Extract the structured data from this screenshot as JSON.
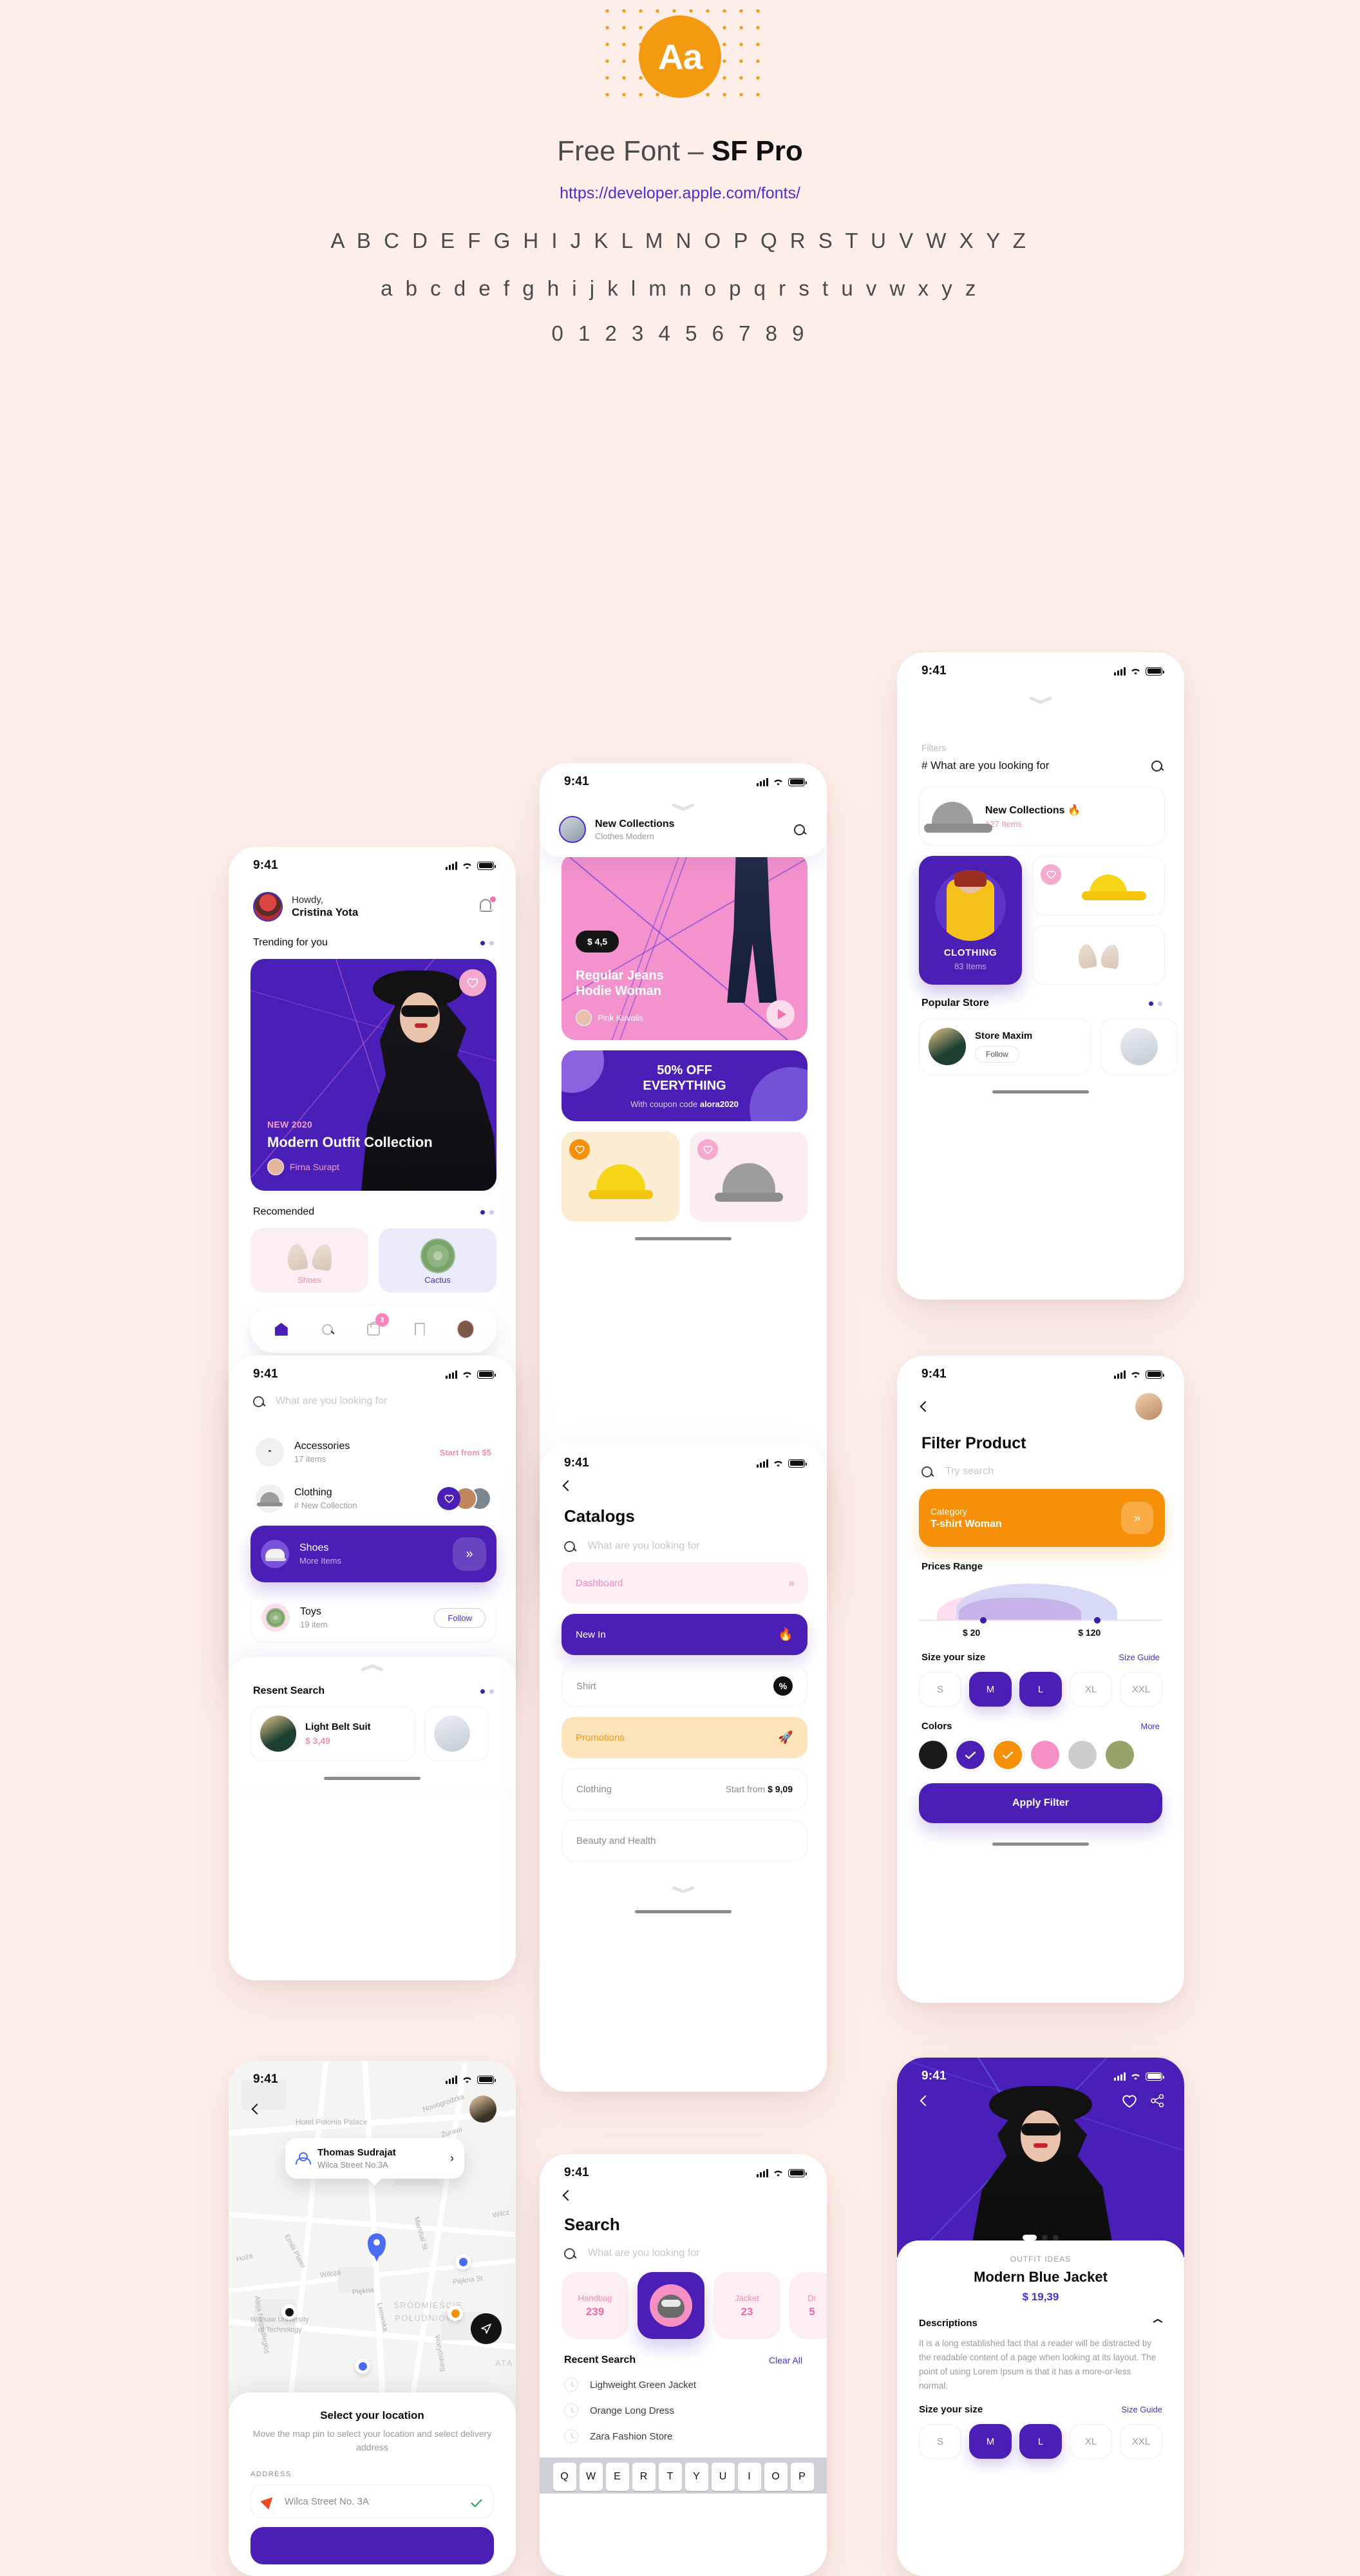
{
  "specimen": {
    "badge": "Aa",
    "title_light": "Free Font – ",
    "title_bold": "SF Pro",
    "url": "https://developer.apple.com/fonts/",
    "uppercase": "A B C D E F G H I J K L M N O P Q R S T U V W X Y Z",
    "lowercase": "a b c d e f g h i j k l m n o p q r s t u v w x y z",
    "numerals": "0 1 2 3 4 5 6 7 8 9"
  },
  "status_bar": {
    "time": "9:41"
  },
  "colors": {
    "accent_purple": "#4b1fb5",
    "accent_orange": "#f79009",
    "accent_pink": "#f489bb",
    "link_purple": "#4b2fd1",
    "page_bg": "#fdeeea"
  },
  "home_screen": {
    "greeting_line1": "Howdy,",
    "greeting_line2": "Cristina Yota",
    "section_trending": "Trending for you",
    "hero": {
      "tag": "NEW 2020",
      "title": "Modern Outfit Collection",
      "author": "Firna Surapt"
    },
    "section_recommended": "Recomended",
    "recommended": [
      {
        "label": "Shoes"
      },
      {
        "label": "Cactus"
      }
    ],
    "tabbar": {
      "cart_badge": "3"
    }
  },
  "new_collections": {
    "title": "New Collections",
    "subtitle": "Clothes Modern",
    "product": {
      "price": "$ 4,5",
      "title_line1": "Regular Jeans",
      "title_line2": "Hodie Woman",
      "author": "Pink Kuvalis"
    },
    "promo": {
      "line1": "50% OFF",
      "line2": "EVERYTHING",
      "sub_prefix": "With coupon code ",
      "sub_code": "alora2020"
    }
  },
  "filters_screen": {
    "label": "Filters",
    "query": "# What are you looking for",
    "featured": {
      "title": "New Collections 🔥",
      "items": "127 Items"
    },
    "clothing_card": {
      "title": "CLOTHING",
      "items": "83 Items"
    },
    "section_popular": "Popular Store",
    "store": {
      "name": "Store Maxim",
      "follow": "Follow"
    }
  },
  "categories_screen": {
    "search_placeholder": "What are you looking for",
    "items": [
      {
        "title": "Accessories",
        "sub": "17 items",
        "right": "Start from $5"
      },
      {
        "title": "Clothing",
        "sub": "# New Collection",
        "right": ""
      },
      {
        "title": "Shoes",
        "sub": "More Items",
        "right": ""
      },
      {
        "title": "Toys",
        "sub": "19 item",
        "right": "Follow"
      }
    ],
    "recent": {
      "title": "Resent Search",
      "item_title": "Light Belt Suit",
      "item_price": "$ 3,49"
    }
  },
  "catalogs_screen": {
    "title": "Catalogs",
    "search_placeholder": "What are you looking for",
    "items": [
      {
        "label": "Dashboard",
        "right": "»"
      },
      {
        "label": "New In",
        "right": "🔥"
      },
      {
        "label": "Shirt",
        "right": "%"
      },
      {
        "label": "Promotions",
        "right": "🚀"
      },
      {
        "label": "Clothing",
        "right_prefix": "Start from ",
        "right_value": "$ 9,09"
      },
      {
        "label": "Beauty and Health",
        "right": ""
      }
    ]
  },
  "filter_product_screen": {
    "title": "Filter Product",
    "search_placeholder": "Try search",
    "category": {
      "label": "Category",
      "value": "T-shirt Woman"
    },
    "prices": {
      "heading": "Prices Range",
      "min": "$ 20",
      "max": "$ 120"
    },
    "size": {
      "heading": "Size your size",
      "guide": "Size Guide",
      "options": [
        "S",
        "M",
        "L",
        "XL",
        "XXL"
      ],
      "selected": [
        "M",
        "L"
      ]
    },
    "colors": {
      "heading": "Colors",
      "more": "More",
      "swatches": [
        "#1a1a1a",
        "#4b1fb5",
        "#f79009",
        "#f58fc4",
        "#cdcdcd",
        "#94a469"
      ],
      "selected": [
        1,
        2
      ]
    },
    "apply": "Apply Filter"
  },
  "map_screen": {
    "map_labels": [
      "Hotel Polonia Palace",
      "Nowogrodzka",
      "Żurawi",
      "Wilcz",
      "Hoża",
      "Emilii Plater",
      "Wilcza",
      "Marshal St",
      "Piękna",
      "Piękna St",
      "Lwowska",
      "ŚRÓDMIEŚCIE",
      "POŁUDNIOWE",
      "Warsaw University",
      "of Technology",
      "Aleja Niepodległoś",
      "Waryńskieg",
      "ATA"
    ],
    "bubble": {
      "name": "Thomas Sudrajat",
      "address": "Wilca Street No.3A"
    },
    "panel": {
      "title": "Select your location",
      "description": "Move the map pin to select your location and select delivery address",
      "address_label": "ADDRESS",
      "address_value": "Wilca Street No. 3A"
    }
  },
  "search_screen": {
    "title": "Search",
    "search_placeholder": "What are you looking for",
    "chips": [
      {
        "name": "Handbag",
        "count": "239"
      },
      {
        "name": "",
        "count": ""
      },
      {
        "name": "Jacket",
        "count": "23"
      },
      {
        "name": "Dr",
        "count": "5"
      }
    ],
    "recent_title": "Recent Search",
    "clear_all": "Clear All",
    "recent_items": [
      "Lighweight Green Jacket",
      "Orange Long Dress",
      "Zara Fashion Store"
    ],
    "keyboard_row": [
      "Q",
      "W",
      "E",
      "R",
      "T",
      "Y",
      "U",
      "I",
      "O",
      "P"
    ]
  },
  "product_screen": {
    "kicker": "OUTFIT IDEAS",
    "title": "Modern Blue Jacket",
    "price": "$ 19,39",
    "descriptions_heading": "Descriptions",
    "description": "It is a long established fact that a reader will be distracted by the readable content of a page when looking at its layout. The point of using Lorem Ipsum is that it has a more-or-less normal.",
    "size_heading": "Size your size",
    "size_guide": "Size Guide",
    "sizes": [
      "S",
      "M",
      "L",
      "XL",
      "XXL"
    ],
    "selected_sizes": [
      "M",
      "L"
    ]
  }
}
